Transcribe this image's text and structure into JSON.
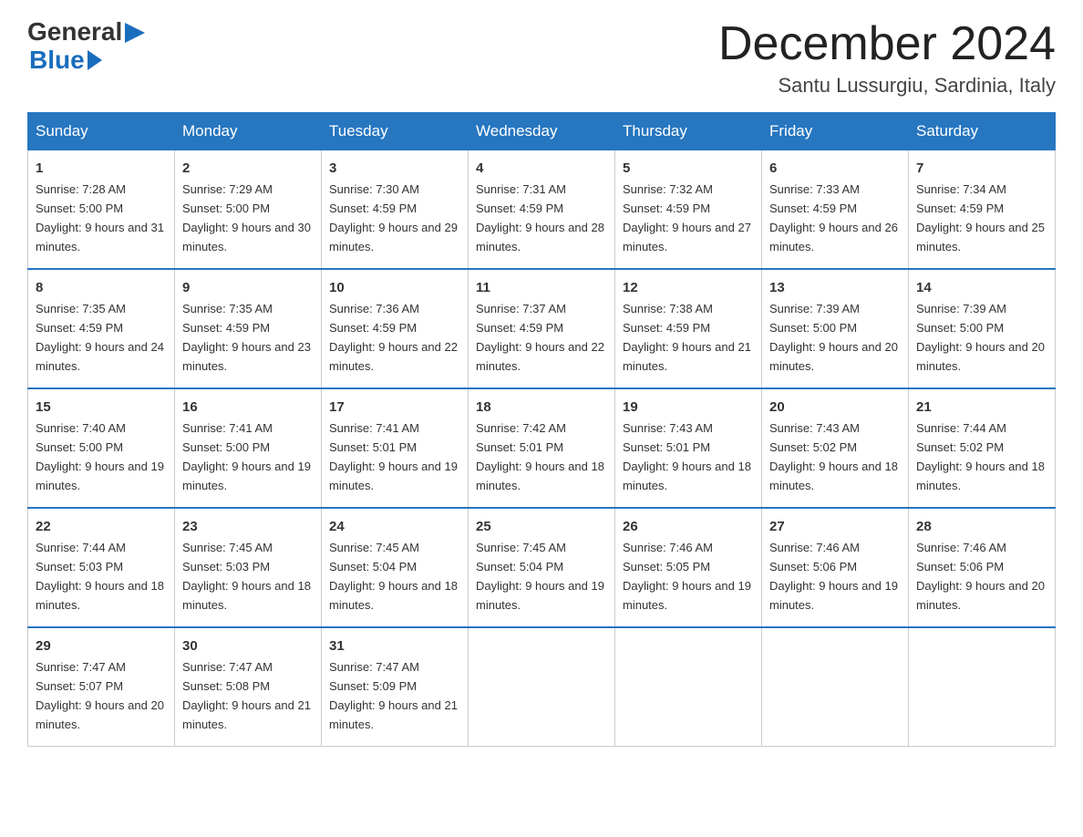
{
  "logo": {
    "general": "General",
    "arrow": "▶",
    "blue": "Blue"
  },
  "header": {
    "month_title": "December 2024",
    "location": "Santu Lussurgiu, Sardinia, Italy"
  },
  "columns": [
    "Sunday",
    "Monday",
    "Tuesday",
    "Wednesday",
    "Thursday",
    "Friday",
    "Saturday"
  ],
  "weeks": [
    [
      {
        "day": "1",
        "sunrise": "7:28 AM",
        "sunset": "5:00 PM",
        "daylight": "9 hours and 31 minutes."
      },
      {
        "day": "2",
        "sunrise": "7:29 AM",
        "sunset": "5:00 PM",
        "daylight": "9 hours and 30 minutes."
      },
      {
        "day": "3",
        "sunrise": "7:30 AM",
        "sunset": "4:59 PM",
        "daylight": "9 hours and 29 minutes."
      },
      {
        "day": "4",
        "sunrise": "7:31 AM",
        "sunset": "4:59 PM",
        "daylight": "9 hours and 28 minutes."
      },
      {
        "day": "5",
        "sunrise": "7:32 AM",
        "sunset": "4:59 PM",
        "daylight": "9 hours and 27 minutes."
      },
      {
        "day": "6",
        "sunrise": "7:33 AM",
        "sunset": "4:59 PM",
        "daylight": "9 hours and 26 minutes."
      },
      {
        "day": "7",
        "sunrise": "7:34 AM",
        "sunset": "4:59 PM",
        "daylight": "9 hours and 25 minutes."
      }
    ],
    [
      {
        "day": "8",
        "sunrise": "7:35 AM",
        "sunset": "4:59 PM",
        "daylight": "9 hours and 24 minutes."
      },
      {
        "day": "9",
        "sunrise": "7:35 AM",
        "sunset": "4:59 PM",
        "daylight": "9 hours and 23 minutes."
      },
      {
        "day": "10",
        "sunrise": "7:36 AM",
        "sunset": "4:59 PM",
        "daylight": "9 hours and 22 minutes."
      },
      {
        "day": "11",
        "sunrise": "7:37 AM",
        "sunset": "4:59 PM",
        "daylight": "9 hours and 22 minutes."
      },
      {
        "day": "12",
        "sunrise": "7:38 AM",
        "sunset": "4:59 PM",
        "daylight": "9 hours and 21 minutes."
      },
      {
        "day": "13",
        "sunrise": "7:39 AM",
        "sunset": "5:00 PM",
        "daylight": "9 hours and 20 minutes."
      },
      {
        "day": "14",
        "sunrise": "7:39 AM",
        "sunset": "5:00 PM",
        "daylight": "9 hours and 20 minutes."
      }
    ],
    [
      {
        "day": "15",
        "sunrise": "7:40 AM",
        "sunset": "5:00 PM",
        "daylight": "9 hours and 19 minutes."
      },
      {
        "day": "16",
        "sunrise": "7:41 AM",
        "sunset": "5:00 PM",
        "daylight": "9 hours and 19 minutes."
      },
      {
        "day": "17",
        "sunrise": "7:41 AM",
        "sunset": "5:01 PM",
        "daylight": "9 hours and 19 minutes."
      },
      {
        "day": "18",
        "sunrise": "7:42 AM",
        "sunset": "5:01 PM",
        "daylight": "9 hours and 18 minutes."
      },
      {
        "day": "19",
        "sunrise": "7:43 AM",
        "sunset": "5:01 PM",
        "daylight": "9 hours and 18 minutes."
      },
      {
        "day": "20",
        "sunrise": "7:43 AM",
        "sunset": "5:02 PM",
        "daylight": "9 hours and 18 minutes."
      },
      {
        "day": "21",
        "sunrise": "7:44 AM",
        "sunset": "5:02 PM",
        "daylight": "9 hours and 18 minutes."
      }
    ],
    [
      {
        "day": "22",
        "sunrise": "7:44 AM",
        "sunset": "5:03 PM",
        "daylight": "9 hours and 18 minutes."
      },
      {
        "day": "23",
        "sunrise": "7:45 AM",
        "sunset": "5:03 PM",
        "daylight": "9 hours and 18 minutes."
      },
      {
        "day": "24",
        "sunrise": "7:45 AM",
        "sunset": "5:04 PM",
        "daylight": "9 hours and 18 minutes."
      },
      {
        "day": "25",
        "sunrise": "7:45 AM",
        "sunset": "5:04 PM",
        "daylight": "9 hours and 19 minutes."
      },
      {
        "day": "26",
        "sunrise": "7:46 AM",
        "sunset": "5:05 PM",
        "daylight": "9 hours and 19 minutes."
      },
      {
        "day": "27",
        "sunrise": "7:46 AM",
        "sunset": "5:06 PM",
        "daylight": "9 hours and 19 minutes."
      },
      {
        "day": "28",
        "sunrise": "7:46 AM",
        "sunset": "5:06 PM",
        "daylight": "9 hours and 20 minutes."
      }
    ],
    [
      {
        "day": "29",
        "sunrise": "7:47 AM",
        "sunset": "5:07 PM",
        "daylight": "9 hours and 20 minutes."
      },
      {
        "day": "30",
        "sunrise": "7:47 AM",
        "sunset": "5:08 PM",
        "daylight": "9 hours and 21 minutes."
      },
      {
        "day": "31",
        "sunrise": "7:47 AM",
        "sunset": "5:09 PM",
        "daylight": "9 hours and 21 minutes."
      },
      null,
      null,
      null,
      null
    ]
  ]
}
